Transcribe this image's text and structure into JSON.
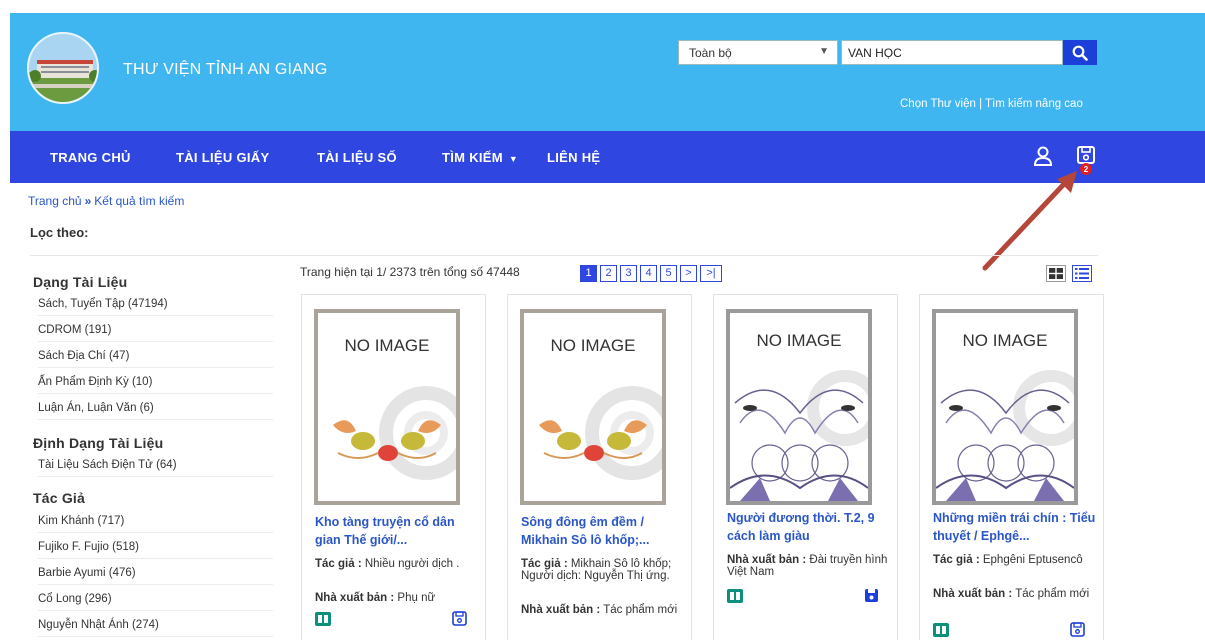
{
  "header": {
    "site_title": "THƯ VIỆN TỈNH AN GIANG",
    "search_scope": "Toàn bộ",
    "search_value": "VAN HỌC",
    "links": "Chọn Thư viện | Tìm kiếm nâng cao"
  },
  "nav": {
    "items": [
      "TRANG CHỦ",
      "TÀI LIỆU GIẤY",
      "TÀI LIỆU SỐ",
      "TÌM KIẾM",
      "LIÊN HỆ"
    ],
    "saved_count": "2"
  },
  "breadcrumb": {
    "home": "Trang chủ",
    "current": "Kết quả tìm kiếm"
  },
  "filter_title": "Lọc theo:",
  "sidebar": {
    "groups": [
      {
        "title": "Dạng Tài Liệu",
        "items": [
          "Sách, Tuyển Tập (47194)",
          "CDROM (191)",
          "Sách Địa Chí (47)",
          "Ấn Phẩm Định Kỳ (10)",
          "Luận Án, Luận Văn (6)"
        ]
      },
      {
        "title": "Định Dạng Tài Liệu",
        "items": [
          "Tài Liệu Sách Điện Tử (64)"
        ]
      },
      {
        "title": "Tác Giả",
        "items": [
          "Kim Khánh (717)",
          "Fujiko F. Fujio (518)",
          "Barbie Ayumi (476)",
          "Cổ Long (296)",
          "Nguyễn Nhật Ánh (274)"
        ]
      }
    ]
  },
  "results": {
    "page_info": "Trang hiện tại 1/ 2373 trên tổng số 47448",
    "pages": [
      "1",
      "2",
      "3",
      "4",
      "5",
      ">",
      ">|"
    ],
    "active_page": "1"
  },
  "cards": [
    {
      "cover_text": "NO IMAGE",
      "title": "Kho tàng truyện cổ dân gian Thế giới/...",
      "author_label": "Tác giả :",
      "author": " Nhiều người dịch .",
      "publisher_label": "Nhà xuất bản :",
      "publisher": " Phụ nữ"
    },
    {
      "cover_text": "NO IMAGE",
      "title": "Sông đông êm đềm / Mikhain Sô lô khốp;...",
      "author_label": "Tác giả :",
      "author": " Mikhain Sô lô khốp; Người dịch: Nguyễn Thị ứng.",
      "publisher_label": "Nhà xuất bản :",
      "publisher": " Tác phẩm mới"
    },
    {
      "cover_text": "NO IMAGE",
      "title": "Người đương thời. T.2, 9 cách làm giàu",
      "author_label": "",
      "author": "",
      "publisher_label": "Nhà xuất bản :",
      "publisher": " Đài truyền hình Việt Nam"
    },
    {
      "cover_text": "NO IMAGE",
      "title": "Những miền trái chín : Tiểu thuyết / Ephgê...",
      "author_label": "Tác giả :",
      "author": " Ephgêni Eptusencô",
      "publisher_label": "Nhà xuất bản :",
      "publisher": " Tác phẩm mới"
    }
  ],
  "colors": {
    "header_bg": "#3fb6f0",
    "nav_bg": "#2f46e0",
    "link": "#2a56c6",
    "annotation_arrow": "#b4473a"
  },
  "icons": [
    "search-icon",
    "user-icon",
    "save-icon",
    "grid-view-icon",
    "list-view-icon",
    "book-icon"
  ]
}
